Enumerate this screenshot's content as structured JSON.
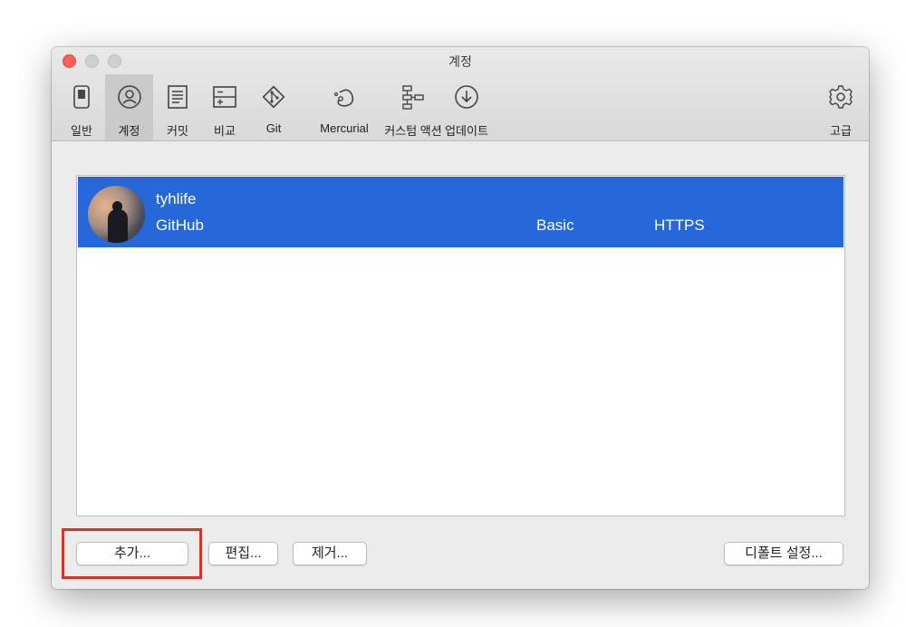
{
  "window": {
    "title": "계정"
  },
  "toolbar": {
    "items": [
      {
        "label": "일반",
        "icon": "switch-icon"
      },
      {
        "label": "계정",
        "icon": "account-icon",
        "selected": true
      },
      {
        "label": "커밋",
        "icon": "document-icon"
      },
      {
        "label": "비교",
        "icon": "compare-icon"
      },
      {
        "label": "Git",
        "icon": "git-icon"
      },
      {
        "label": "Mercurial",
        "icon": "mercurial-icon"
      },
      {
        "label": "커스텀 액션",
        "icon": "custom-actions-icon"
      },
      {
        "label": "업데이트",
        "icon": "update-icon"
      },
      {
        "label": "고급",
        "icon": "gear-icon"
      }
    ]
  },
  "accounts": [
    {
      "username": "tyhlife",
      "host": "GitHub",
      "auth": "Basic",
      "protocol": "HTTPS"
    }
  ],
  "buttons": {
    "add": "추가...",
    "edit": "편집...",
    "remove": "제거...",
    "default_settings": "디폴트 설정..."
  },
  "colors": {
    "selection": "#2468d9",
    "highlight": "#d9312b"
  }
}
